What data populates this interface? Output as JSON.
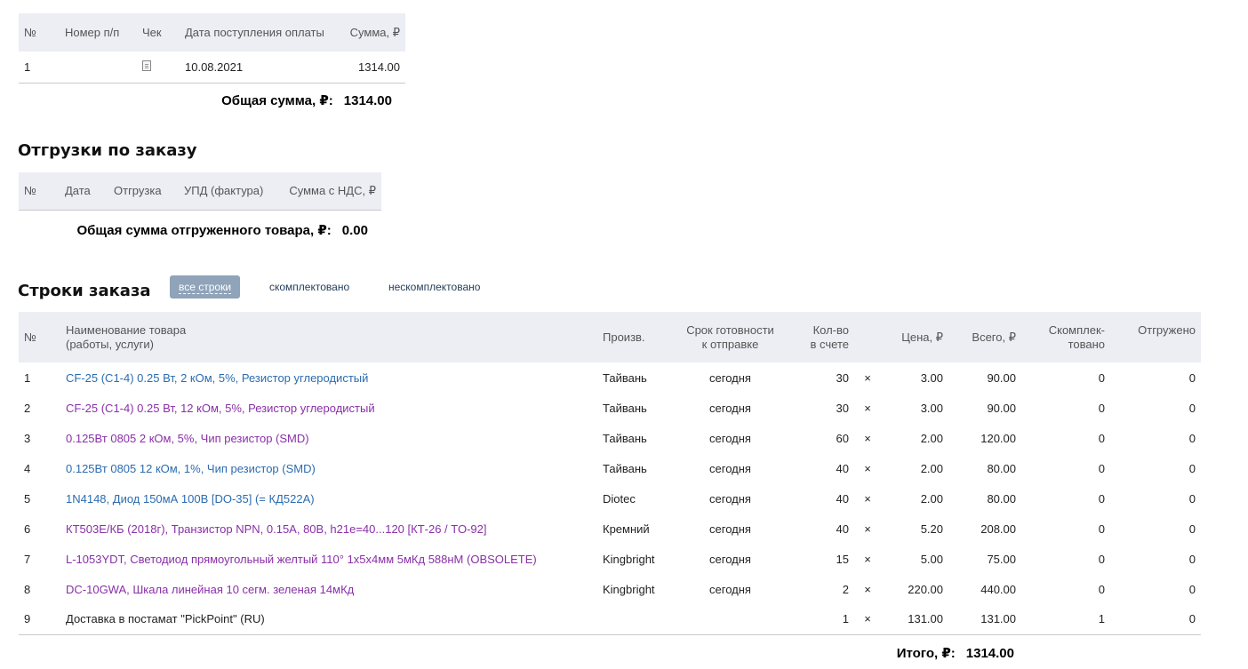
{
  "payments": {
    "headers": [
      "№",
      "Номер п/п",
      "Чек",
      "Дата поступления оплаты",
      "Сумма, ₽"
    ],
    "rows": [
      {
        "n": "1",
        "pp": "",
        "check_icon": "document-icon",
        "date": "10.08.2021",
        "sum": "1314.00"
      }
    ],
    "total_label": "Общая сумма, ₽:",
    "total_value": "1314.00"
  },
  "shipments": {
    "title": "Отгрузки по заказу",
    "headers": [
      "№",
      "Дата",
      "Отгрузка",
      "УПД (фактура)",
      "Сумма с НДС, ₽"
    ],
    "total_label": "Общая сумма отгруженного товара, ₽:",
    "total_value": "0.00"
  },
  "order_lines": {
    "title": "Строки заказа",
    "filters": {
      "all": "все строки",
      "complete": "скомплектовано",
      "incomplete": "нескомплектовано"
    },
    "headers": {
      "n": "№",
      "name_1": "Наименование товара",
      "name_2": "(работы, услуги)",
      "maker": "Произв.",
      "ready_1": "Срок готовности",
      "ready_2": "к отправке",
      "qty_1": "Кол-во",
      "qty_2": "в счете",
      "price": "Цена, ₽",
      "total": "Всего, ₽",
      "picked_1": "Скомплек-",
      "picked_2": "товано",
      "shipped": "Отгружено"
    },
    "rows": [
      {
        "n": "1",
        "name": "CF-25 (С1-4) 0.25 Вт, 2 кОм, 5%, Резистор углеродистый",
        "maker": "Тайвань",
        "ready": "сегодня",
        "qty": "30",
        "x": "×",
        "price": "3.00",
        "total": "90.00",
        "picked": "0",
        "shipped": "0"
      },
      {
        "n": "2",
        "name": "CF-25 (С1-4) 0.25 Вт, 12 кОм, 5%, Резистор углеродистый",
        "maker": "Тайвань",
        "ready": "сегодня",
        "qty": "30",
        "x": "×",
        "price": "3.00",
        "total": "90.00",
        "picked": "0",
        "shipped": "0"
      },
      {
        "n": "3",
        "name": "0.125Вт 0805 2 кОм, 5%, Чип резистор (SMD)",
        "maker": "Тайвань",
        "ready": "сегодня",
        "qty": "60",
        "x": "×",
        "price": "2.00",
        "total": "120.00",
        "picked": "0",
        "shipped": "0"
      },
      {
        "n": "4",
        "name": "0.125Вт 0805 12 кОм, 1%, Чип резистор (SMD)",
        "maker": "Тайвань",
        "ready": "сегодня",
        "qty": "40",
        "x": "×",
        "price": "2.00",
        "total": "80.00",
        "picked": "0",
        "shipped": "0"
      },
      {
        "n": "5",
        "name": "1N4148, Диод 150мА 100В [DO-35] (= КД522А)",
        "maker": "Diotec",
        "ready": "сегодня",
        "qty": "40",
        "x": "×",
        "price": "2.00",
        "total": "80.00",
        "picked": "0",
        "shipped": "0"
      },
      {
        "n": "6",
        "name": "КТ503Е/КБ (2018г), Транзистор NPN, 0.15А, 80В, h21е=40...120 [КТ-26 / TO-92]",
        "maker": "Кремний",
        "ready": "сегодня",
        "qty": "40",
        "x": "×",
        "price": "5.20",
        "total": "208.00",
        "picked": "0",
        "shipped": "0"
      },
      {
        "n": "7",
        "name": "L-1053YDT, Светодиод прямоугольный желтый 110° 1x5x4мм 5мКд 588нМ (OBSOLETE)",
        "maker": "Kingbright",
        "ready": "сегодня",
        "qty": "15",
        "x": "×",
        "price": "5.00",
        "total": "75.00",
        "picked": "0",
        "shipped": "0"
      },
      {
        "n": "8",
        "name": "DC-10GWA, Шкала линейная 10 сегм. зеленая 14мКд",
        "maker": "Kingbright",
        "ready": "сегодня",
        "qty": "2",
        "x": "×",
        "price": "220.00",
        "total": "440.00",
        "picked": "0",
        "shipped": "0"
      },
      {
        "n": "9",
        "name": "Доставка в постамат \"PickPoint\" (RU)",
        "maker": "",
        "ready": "",
        "qty": "1",
        "x": "×",
        "price": "131.00",
        "total": "131.00",
        "picked": "1",
        "shipped": "0"
      }
    ],
    "total_label": "Итого, ₽:",
    "total_value": "1314.00"
  },
  "colors": {
    "link_blue": "#2b6cb0",
    "link_purple": "#8a2fa8",
    "header_bg": "#eceef4",
    "filter_active_bg": "#8fa3b9"
  }
}
